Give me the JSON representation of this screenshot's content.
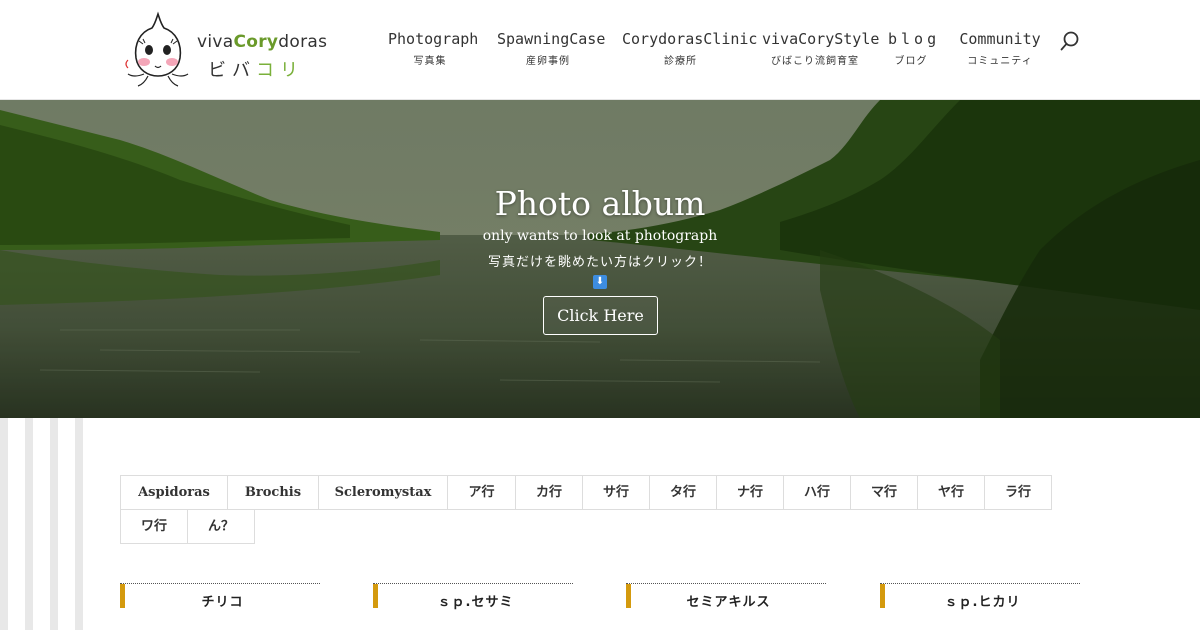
{
  "logo": {
    "name_prefix": "viva",
    "name_accent": "Cory",
    "name_suffix": "doras",
    "kana_plain": "ビバ",
    "kana_accent": "コリ"
  },
  "nav": {
    "items": [
      {
        "en": "Photograph",
        "ja": "写真集"
      },
      {
        "en": "SpawningCase",
        "ja": "産卵事例"
      },
      {
        "en": "CorydorasClinic",
        "ja": "診療所"
      },
      {
        "en": "vivaCoryStyle",
        "ja": "びばこり流飼育室"
      },
      {
        "en": "blog",
        "ja": "ブログ"
      },
      {
        "en": "Community",
        "ja": "コミュニティ"
      }
    ],
    "search_icon": "search-icon"
  },
  "hero": {
    "title": "Photo album",
    "subtitle_en": "only wants to look at photograph",
    "subtitle_ja": "写真だけを眺めたい方はクリック！",
    "arrow_icon": "arrow-down-icon",
    "button_label": "Click Here"
  },
  "tabs": [
    "Aspidoras",
    "Brochis",
    "Scleromystax",
    "ア行",
    "カ行",
    "サ行",
    "タ行",
    "ナ行",
    "ハ行",
    "マ行",
    "ヤ行",
    "ラ行",
    "ワ行",
    "ん？"
  ],
  "cards": [
    {
      "label": "チリコ"
    },
    {
      "label": "ｓｐ.セサミ"
    },
    {
      "label": "セミアキルス"
    },
    {
      "label": "ｓｐ.ヒカリ"
    }
  ],
  "colors": {
    "card_accent": "#d49a0e",
    "logo_green": "#6a9a2a",
    "arrow_blue": "#3d8de0"
  }
}
